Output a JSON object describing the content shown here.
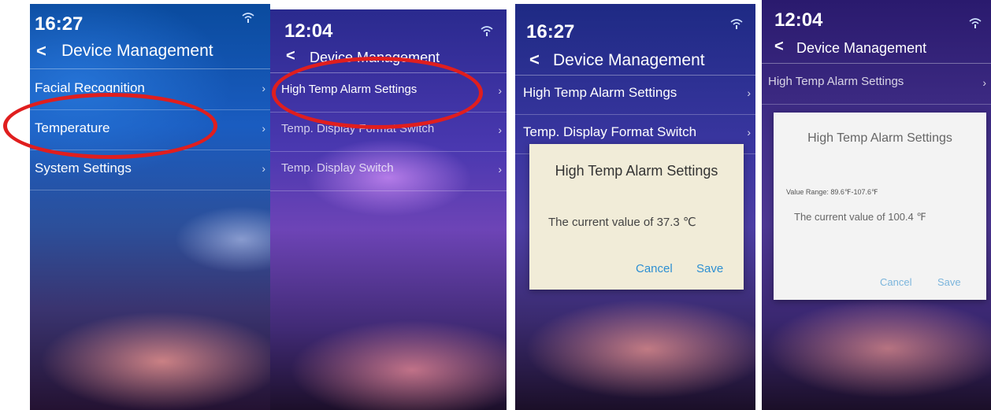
{
  "panels": [
    {
      "time": "16:27",
      "header": {
        "title": "Device Management"
      },
      "items": [
        {
          "label": "Facial Recognition"
        },
        {
          "label": "Temperature"
        },
        {
          "label": "System Settings"
        }
      ]
    },
    {
      "time": "12:04",
      "header": {
        "title": "Device Management"
      },
      "items": [
        {
          "label": "High Temp Alarm Settings"
        },
        {
          "label": "Temp. Display Format Switch"
        },
        {
          "label": "Temp. Display Switch"
        }
      ]
    },
    {
      "time": "16:27",
      "header": {
        "title": "Device Management"
      },
      "items": [
        {
          "label": "High Temp Alarm Settings"
        },
        {
          "label": "Temp. Display Format Switch"
        }
      ],
      "dialog": {
        "title": "High Temp Alarm Settings",
        "value_text": "The current value of 37.3 ℃",
        "cancel_label": "Cancel",
        "save_label": "Save"
      }
    },
    {
      "time": "12:04",
      "header": {
        "title": "Device Management"
      },
      "items": [
        {
          "label": "High Temp Alarm Settings"
        }
      ],
      "dialog": {
        "title": "High Temp Alarm Settings",
        "range_text": "Value Range: 89.6℉-107.6℉",
        "value_text": "The current value of 100.4 ℉",
        "cancel_label": "Cancel",
        "save_label": "Save"
      }
    }
  ],
  "colors": {
    "highlight_circle": "#e01e1e",
    "dialog_button": "#2d8fd2"
  }
}
